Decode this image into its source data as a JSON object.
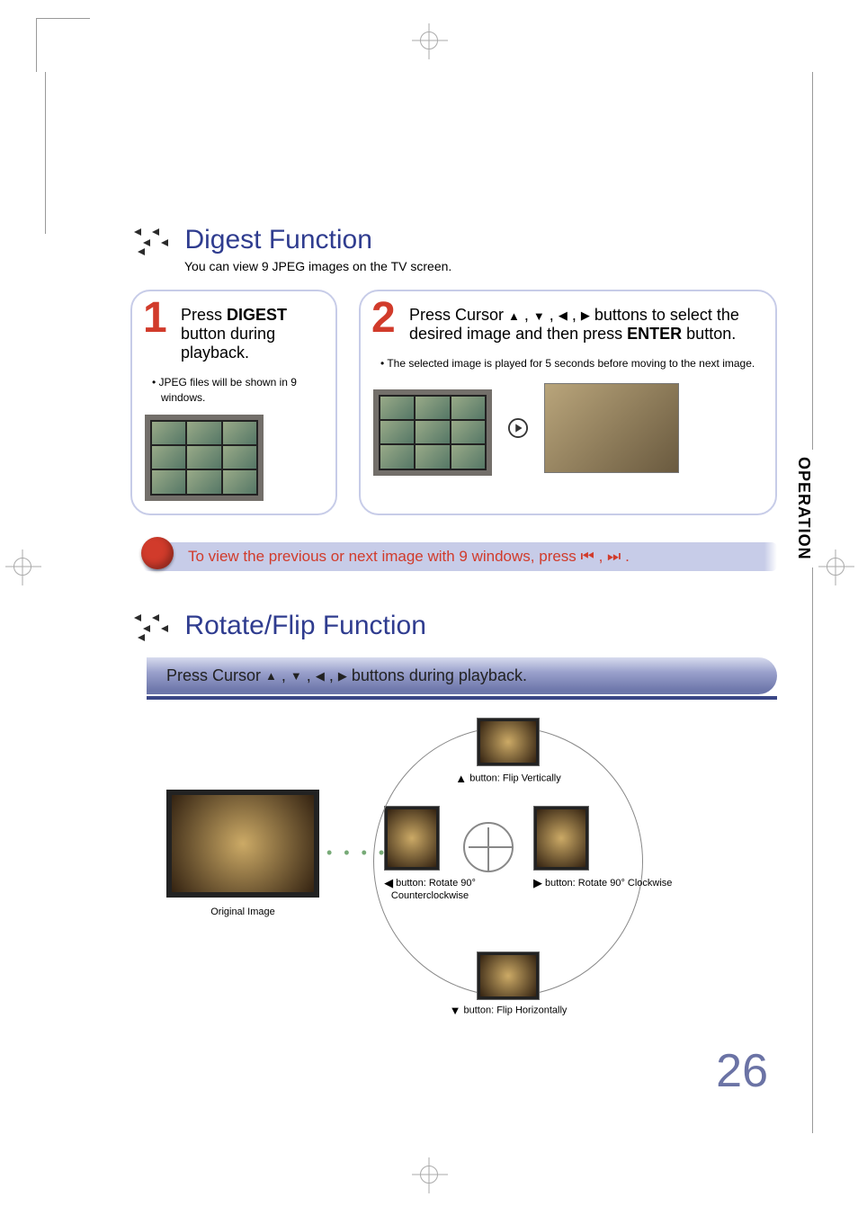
{
  "sideTab": "OPERATION",
  "pageNumber": "26",
  "section1": {
    "title": "Digest Function",
    "subtitle": "You can view 9 JPEG images on the TV screen."
  },
  "step1": {
    "num": "1",
    "lead": "Press ",
    "bold": "DIGEST",
    "tail": " button during playback.",
    "bullet": "• JPEG files will be shown in 9 windows."
  },
  "step2": {
    "num": "2",
    "line1a": "Press Cursor ",
    "line1b": " buttons to select the desired image and then press ",
    "bold": "ENTER",
    "tail": " button.",
    "bullet": "• The selected image is played for 5 seconds before moving to the next image."
  },
  "prevNext": {
    "a": "To view the previous or next image with 9 windows, press ",
    "b": " ."
  },
  "section2": {
    "title": "Rotate/Flip Function",
    "pressLine": "Press Cursor      ,     ,     ,      buttons during playback."
  },
  "diagram": {
    "original": "Original Image",
    "top": " button: Flip Vertically",
    "bottom": " button: Flip Horizontally",
    "left": " button: Rotate 90° Counterclockwise",
    "right": " button: Rotate 90° Clockwise"
  }
}
